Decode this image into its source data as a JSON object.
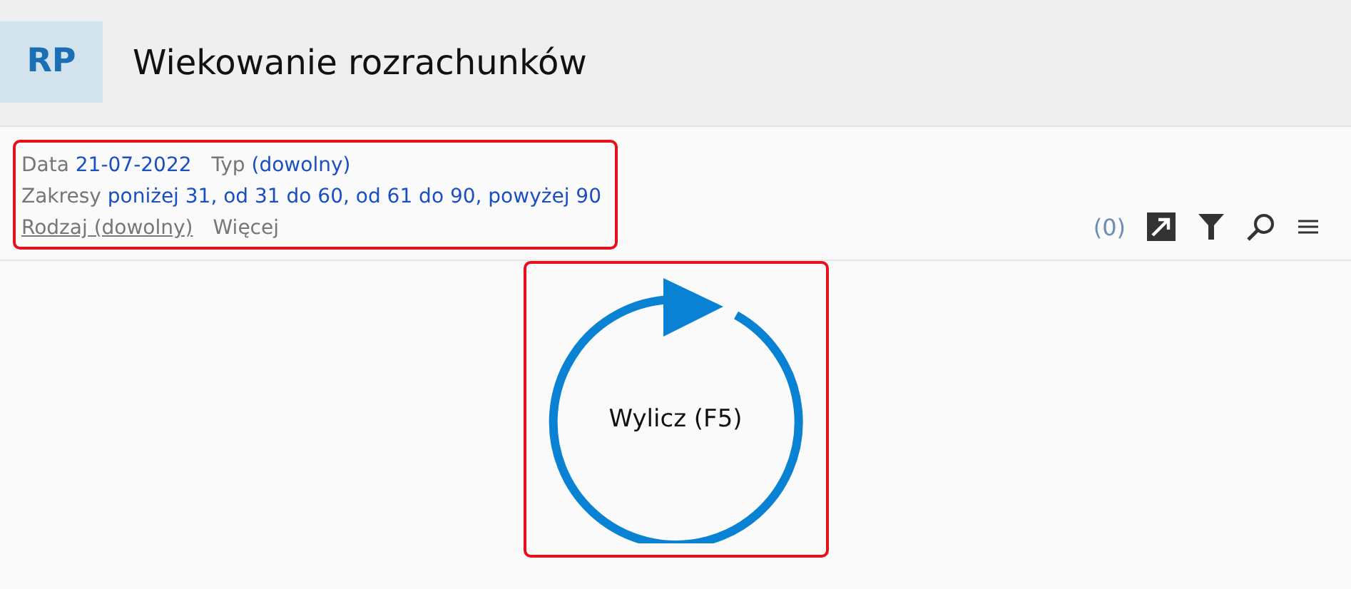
{
  "header": {
    "badge": "RP",
    "title": "Wiekowanie rozrachunków"
  },
  "filters": {
    "rows": [
      [
        {
          "kind": "pair",
          "label": "Data",
          "value": "21-07-2022"
        },
        {
          "kind": "pair",
          "label": "Typ",
          "value": "(dowolny)"
        }
      ],
      [
        {
          "kind": "pair",
          "label": "Zakresy",
          "value": "poniżej 31, od 31 do 60, od 61 do 90, powyżej 90"
        }
      ],
      [
        {
          "kind": "link",
          "label": "Rodzaj (dowolny)"
        },
        {
          "kind": "plain",
          "label": "Więcej"
        }
      ]
    ]
  },
  "toolbar": {
    "count": "(0)"
  },
  "calculate_button": {
    "label": "Wylicz (F5)"
  }
}
